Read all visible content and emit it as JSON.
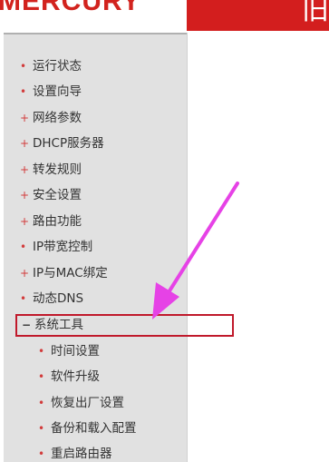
{
  "header": {
    "logo_text": "MERCURY",
    "banner_glyph": "旧",
    "colors": {
      "brand_red": "#d31e1e"
    }
  },
  "sidebar": {
    "items": [
      {
        "label": "运行状态",
        "bullet": "•"
      },
      {
        "label": "设置向导",
        "bullet": "•"
      },
      {
        "label": "网络参数",
        "bullet": "+"
      },
      {
        "label": "DHCP服务器",
        "bullet": "+"
      },
      {
        "label": "转发规则",
        "bullet": "+"
      },
      {
        "label": "安全设置",
        "bullet": "+"
      },
      {
        "label": "路由功能",
        "bullet": "+"
      },
      {
        "label": "IP带宽控制",
        "bullet": "•"
      },
      {
        "label": "IP与MAC绑定",
        "bullet": "+"
      },
      {
        "label": "动态DNS",
        "bullet": "•"
      },
      {
        "label": "系统工具",
        "bullet": "−",
        "expanded": true,
        "highlighted": true
      }
    ],
    "subitems": [
      {
        "label": "时间设置",
        "bullet": "•"
      },
      {
        "label": "软件升级",
        "bullet": "•"
      },
      {
        "label": "恢复出厂设置",
        "bullet": "•"
      },
      {
        "label": "备份和载入配置",
        "bullet": "•"
      },
      {
        "label": "重启路由器",
        "bullet": "•"
      }
    ]
  },
  "annotation": {
    "arrow_color": "#e642e6",
    "box_color": "#c0192b"
  }
}
